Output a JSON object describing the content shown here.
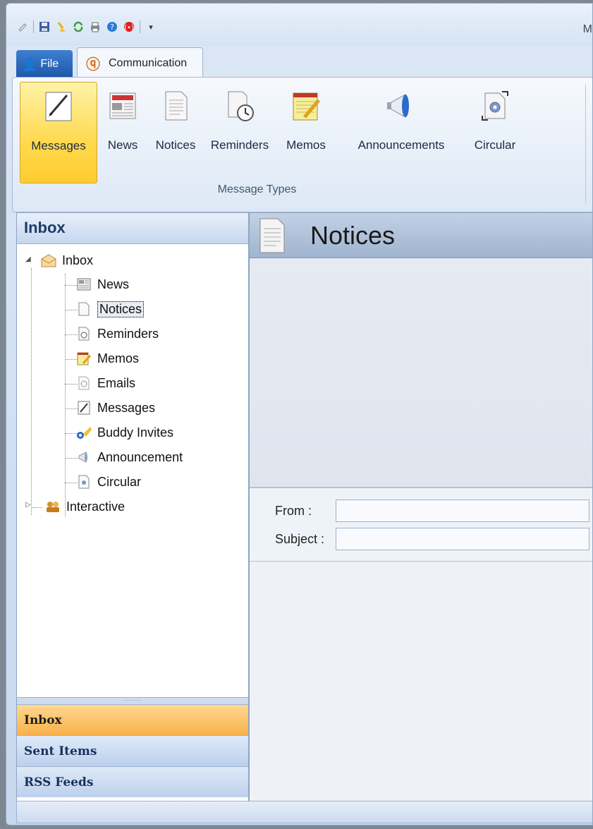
{
  "window": {
    "title_partial": "M"
  },
  "quick_access": {
    "icons": [
      "app-icon",
      "save-icon",
      "broom-icon",
      "refresh-icon",
      "print-icon",
      "help-icon",
      "stop-icon",
      "customize-arrow-icon"
    ]
  },
  "tabs": {
    "file": "File",
    "communication": "Communication"
  },
  "ribbon": {
    "buttons": [
      {
        "label": "Messages",
        "icon": "pen-paper-icon",
        "active": true
      },
      {
        "label": "News",
        "icon": "newspaper-icon"
      },
      {
        "label": "Notices",
        "icon": "document-icon"
      },
      {
        "label": "Reminders",
        "icon": "clock-document-icon"
      },
      {
        "label": "Memos",
        "icon": "notepad-pencil-icon"
      },
      {
        "label": "Announcements",
        "icon": "megaphone-icon"
      },
      {
        "label": "Circular",
        "icon": "circular-gear-icon"
      }
    ],
    "group_label": "Message Types"
  },
  "nav": {
    "header": "Inbox",
    "tree": {
      "root": "Inbox",
      "children": [
        "News",
        "Notices",
        "Reminders",
        "Memos",
        "Emails",
        "Messages",
        "Buddy Invites",
        "Announcement",
        "Circular"
      ],
      "selected": "Notices",
      "sibling": "Interactive"
    },
    "buttons": [
      "Inbox",
      "Sent Items",
      "RSS Feeds"
    ],
    "active_button": "Inbox"
  },
  "content": {
    "title": "Notices",
    "from_label": "From :",
    "subject_label": "Subject :",
    "from_value": "",
    "subject_value": ""
  },
  "colors": {
    "accent_yellow": "#ffd94e",
    "nav_active": "#f7b14a",
    "header_blue": "#1d3b6b"
  }
}
